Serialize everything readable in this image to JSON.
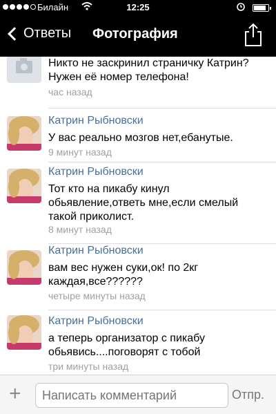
{
  "status_bar": {
    "carrier": "Билайн",
    "time": "12:25",
    "battery_level": 0.85
  },
  "nav": {
    "back_label": "Ответы",
    "title": "Фотография"
  },
  "comments": [
    {
      "author": "",
      "text": "Никто не заскринил страничку Катрин? Нужен её номер телефона!",
      "time": "час назад"
    },
    {
      "author": "Катрин Рыбновски",
      "text": "У вас реально мозгов нет,ебанутые.",
      "time": "9 минут назад"
    },
    {
      "author": "Катрин Рыбновски",
      "text": "Тот кто на пикабу кинул обьявление,ответь мне,если смелый такой приколист.",
      "time": "8 минут назад"
    },
    {
      "author": "Катрин Рыбновски",
      "text": "вам вес нужен суки,ок! по 2кг каждая,все??????",
      "time": "четыре минуты назад"
    },
    {
      "author": "Катрин Рыбновски",
      "text": "а теперь организатор с пикабу обьявись....поговорят с тобой",
      "time": "три минуты назад"
    }
  ],
  "input": {
    "placeholder": "Написать комментарий",
    "send_label": "Отпр."
  },
  "colors": {
    "author": "#4a6d95",
    "timestamp": "#a0a0a0",
    "bar": "#000000"
  }
}
